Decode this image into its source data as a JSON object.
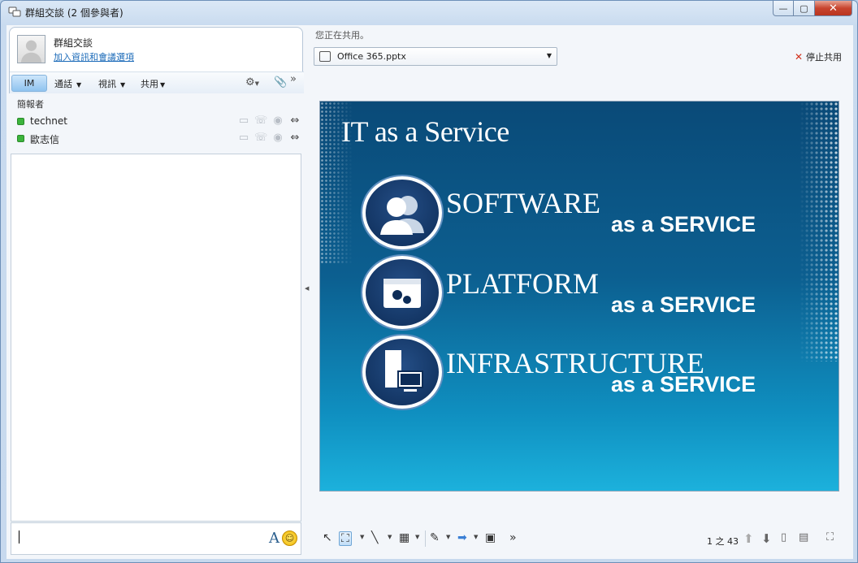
{
  "window": {
    "title": "群組交談 (2 個參與者)",
    "minimize": "—",
    "maximize": "▢",
    "close": "✕"
  },
  "conversation": {
    "title": "群組交談",
    "link": "加入資訊和會議選項"
  },
  "toolbar": {
    "im": "IM",
    "call": "通話",
    "video": "視訊",
    "share": "共用",
    "more": "»"
  },
  "participants": {
    "header": "簡報者",
    "list": [
      {
        "name": "technet",
        "status_color": "#3cb43c"
      },
      {
        "name": "歐志信",
        "status_color": "#3cb43c"
      }
    ]
  },
  "input": {
    "font_icon": "A",
    "emoji_icon": "☺"
  },
  "share": {
    "note": "您正在共用。",
    "file": "Office 365.pptx",
    "stop": "停止共用"
  },
  "slide": {
    "title": "IT as a Service",
    "items": [
      {
        "name": "SOFTWARE",
        "tag": "as a SERVICE"
      },
      {
        "name": "PLATFORM",
        "tag": "as a SERVICE"
      },
      {
        "name": "INFRASTRUCTURE",
        "tag": "as a SERVICE"
      }
    ]
  },
  "controls": {
    "page": "1 之 43",
    "more": "»"
  }
}
